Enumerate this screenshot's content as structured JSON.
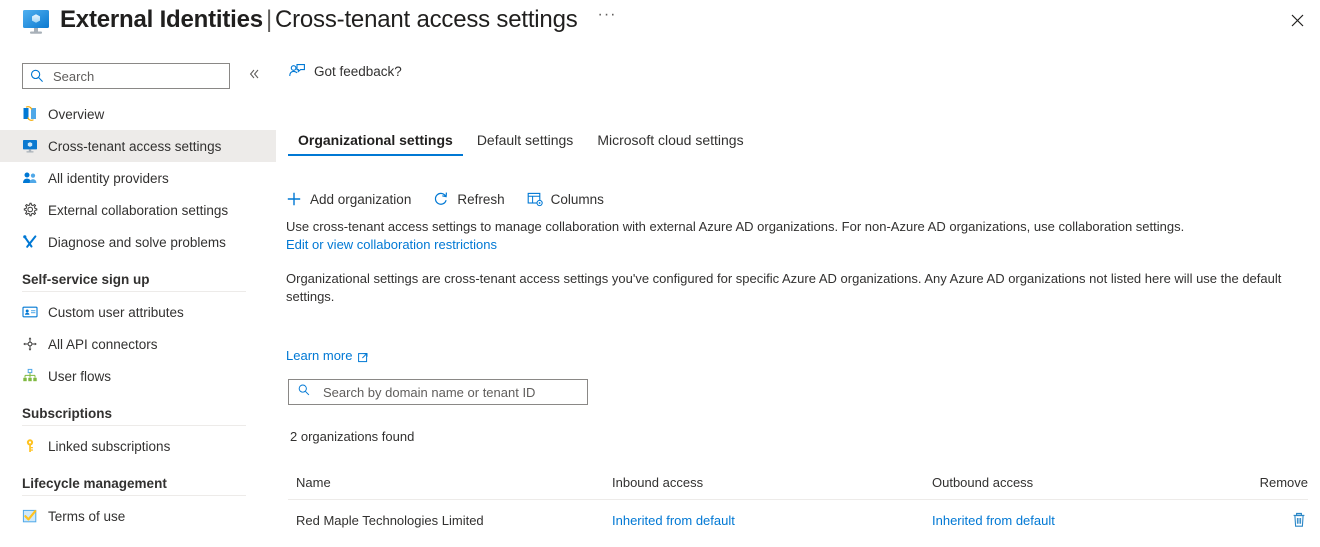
{
  "header": {
    "icon": "monitor-shield-icon",
    "title_main": "External Identities",
    "title_separator": "|",
    "title_sub": "Cross-tenant access settings",
    "ellipsis": "···",
    "close_icon": "close-icon"
  },
  "sidebar": {
    "search_placeholder": "Search",
    "search_value": "",
    "collapse_icon": "chevron-double-left-icon",
    "items": [
      {
        "label": "Overview",
        "icon": "overview-icon",
        "selected": false
      },
      {
        "label": "Cross-tenant access settings",
        "icon": "monitor-shield-icon",
        "selected": true
      },
      {
        "label": "All identity providers",
        "icon": "identity-providers-icon",
        "selected": false
      },
      {
        "label": "External collaboration settings",
        "icon": "gear-icon",
        "selected": false
      },
      {
        "label": "Diagnose and solve problems",
        "icon": "wrench-screwdriver-icon",
        "selected": false
      }
    ],
    "groups": [
      {
        "title": "Self-service sign up",
        "items": [
          {
            "label": "Custom user attributes",
            "icon": "user-card-icon"
          },
          {
            "label": "All API connectors",
            "icon": "connectors-icon"
          },
          {
            "label": "User flows",
            "icon": "user-flows-icon"
          }
        ]
      },
      {
        "title": "Subscriptions",
        "items": [
          {
            "label": "Linked subscriptions",
            "icon": "key-icon"
          }
        ]
      },
      {
        "title": "Lifecycle management",
        "items": [
          {
            "label": "Terms of use",
            "icon": "checkmark-box-icon"
          }
        ]
      }
    ]
  },
  "main": {
    "feedback_label": "Got feedback?",
    "feedback_icon": "feedback-person-icon",
    "tabs": [
      {
        "label": "Organizational settings",
        "active": true
      },
      {
        "label": "Default settings",
        "active": false
      },
      {
        "label": "Microsoft cloud settings",
        "active": false
      }
    ],
    "commands": [
      {
        "label": "Add organization",
        "icon": "plus-icon"
      },
      {
        "label": "Refresh",
        "icon": "refresh-icon"
      },
      {
        "label": "Columns",
        "icon": "columns-icon"
      }
    ],
    "description_1": "Use cross-tenant access settings to manage collaboration with external Azure AD organizations. For non-Azure AD organizations, use collaboration settings.",
    "link_1": "Edit or view collaboration restrictions",
    "description_2": "Organizational settings are cross-tenant access settings you've configured for specific Azure AD organizations. Any Azure AD organizations not listed here will use the default settings.",
    "link_2": "Learn more",
    "link_2_icon": "external-link-icon",
    "table_search_placeholder": "Search by domain name or tenant ID",
    "table_search_value": "",
    "table_search_icon": "search-icon",
    "found_count": "2 organizations found",
    "table": {
      "columns": [
        "Name",
        "Inbound access",
        "Outbound access",
        "Remove"
      ],
      "rows": [
        {
          "name": "Red Maple Technologies Limited",
          "inbound": "Inherited from default",
          "outbound": "Inherited from default",
          "remove_icon": "trash-icon"
        }
      ]
    }
  },
  "colors": {
    "accent": "#0078d4",
    "link": "#0078d4",
    "selected_bg": "#edebe9",
    "text": "#323130",
    "border": "#8a8886"
  }
}
